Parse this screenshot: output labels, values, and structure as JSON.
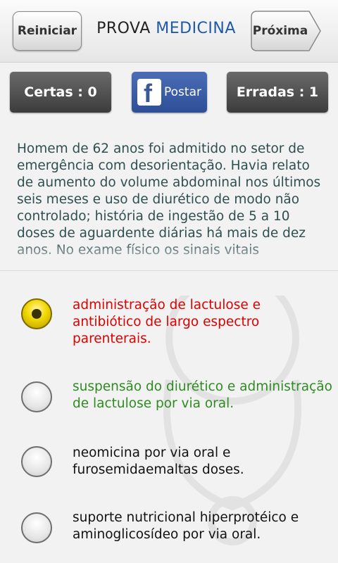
{
  "header": {
    "restart_label": "Reiniciar",
    "title_part1": "PROVA ",
    "title_part2": "MEDICINA",
    "next_label": "Próxima"
  },
  "scores": {
    "correct_label": "Certas : 0",
    "wrong_label": "Erradas : 1"
  },
  "share": {
    "label": "Postar",
    "icon": "facebook-icon"
  },
  "question": {
    "text": "Homem de 62 anos foi admitido no setor de emergência com desorientação. Havia relato de aumento do volume abdominal nos últimos seis meses e uso de diurético de modo não controlado; história de ingestão de 5 a 10 doses de aguardente diárias há mais de dez anos. No exame físico os sinais vitais"
  },
  "options": [
    {
      "text": "administração de lactulose e antibiótico de largo espectro parenterais.",
      "selected": true,
      "color": "#e00000"
    },
    {
      "text": "suspensão do diurético e administração de lactulose por via oral.",
      "selected": false,
      "color": "#2e8b22"
    },
    {
      "text": "neomicina por via oral e furosemidaemaltas doses.",
      "selected": false,
      "color": "#111111"
    },
    {
      "text": "suporte nutricional hiperprotéico e aminoglicosídeo por via oral.",
      "selected": false,
      "color": "#111111"
    }
  ]
}
